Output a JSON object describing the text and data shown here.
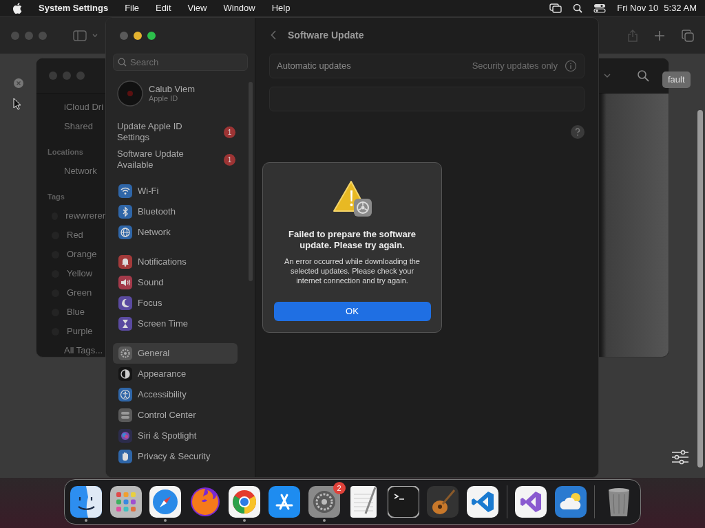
{
  "menu_bar": {
    "app_name": "System Settings",
    "menus": [
      "File",
      "Edit",
      "View",
      "Window",
      "Help"
    ],
    "date": "Fri Nov 10",
    "time": "5:32 AM"
  },
  "browser_window": {
    "button": "fault"
  },
  "finder_window": {
    "sidebar": [
      {
        "kind": "item",
        "label": "iCloud Dri"
      },
      {
        "kind": "item",
        "label": "Shared"
      },
      {
        "kind": "header",
        "label": "Locations"
      },
      {
        "kind": "item",
        "label": "Network"
      },
      {
        "kind": "header",
        "label": "Tags"
      },
      {
        "kind": "tag",
        "label": "rewwrerer"
      },
      {
        "kind": "tag",
        "label": "Red"
      },
      {
        "kind": "tag",
        "label": "Orange"
      },
      {
        "kind": "tag",
        "label": "Yellow"
      },
      {
        "kind": "tag",
        "label": "Green"
      },
      {
        "kind": "tag",
        "label": "Blue"
      },
      {
        "kind": "tag",
        "label": "Purple"
      },
      {
        "kind": "item",
        "label": "All Tags..."
      }
    ]
  },
  "settings_window": {
    "search": {
      "placeholder": "Search"
    },
    "account": {
      "name": "Calub Viem",
      "subtitle": "Apple ID"
    },
    "notices": [
      {
        "label": "Update Apple ID Settings",
        "badge": "1"
      },
      {
        "label": "Software Update Available",
        "badge": "1"
      }
    ],
    "sidebar_groups": [
      [
        {
          "label": "Wi-Fi",
          "color": "#2f66a8",
          "selected": false
        },
        {
          "label": "Bluetooth",
          "color": "#2f66a8",
          "selected": false
        },
        {
          "label": "Network",
          "color": "#2f66a8",
          "selected": false
        }
      ],
      [
        {
          "label": "Notifications",
          "color": "#a33a3a",
          "selected": false
        },
        {
          "label": "Sound",
          "color": "#a33a4a",
          "selected": false
        },
        {
          "label": "Focus",
          "color": "#5a4aa0",
          "selected": false
        },
        {
          "label": "Screen Time",
          "color": "#5a4aa0",
          "selected": false
        }
      ],
      [
        {
          "label": "General",
          "color": "#5a5a5a",
          "selected": true
        },
        {
          "label": "Appearance",
          "color": "#151515",
          "selected": false
        },
        {
          "label": "Accessibility",
          "color": "#2f66a8",
          "selected": false
        },
        {
          "label": "Control Center",
          "color": "#5a5a5a",
          "selected": false
        },
        {
          "label": "Siri & Spotlight",
          "color": "#2c2c4c",
          "selected": false
        },
        {
          "label": "Privacy & Security",
          "color": "#2f66a8",
          "selected": false
        }
      ]
    ],
    "title": "Software Update",
    "settings_rows": [
      {
        "label": "Automatic updates",
        "value": "Security updates only"
      }
    ]
  },
  "dialog": {
    "title": "Failed to prepare the software update. Please try again.",
    "message": "An error occurred while downloading the selected updates. Please check your internet connection and try again.",
    "button": "OK"
  },
  "dock": {
    "items": [
      {
        "kind": "app",
        "running": true
      },
      {
        "kind": "app",
        "running": false
      },
      {
        "kind": "app",
        "running": true
      },
      {
        "kind": "app",
        "running": false
      },
      {
        "kind": "app",
        "running": true
      },
      {
        "kind": "app",
        "running": false
      },
      {
        "kind": "app",
        "running": true,
        "badge": "2"
      },
      {
        "kind": "app",
        "running": false
      },
      {
        "kind": "app",
        "running": false
      },
      {
        "kind": "app",
        "running": false
      },
      {
        "kind": "app",
        "running": false
      },
      {
        "kind": "separator"
      },
      {
        "kind": "app",
        "running": false
      },
      {
        "kind": "app",
        "running": false
      },
      {
        "kind": "separator"
      },
      {
        "kind": "app",
        "running": false
      }
    ]
  }
}
